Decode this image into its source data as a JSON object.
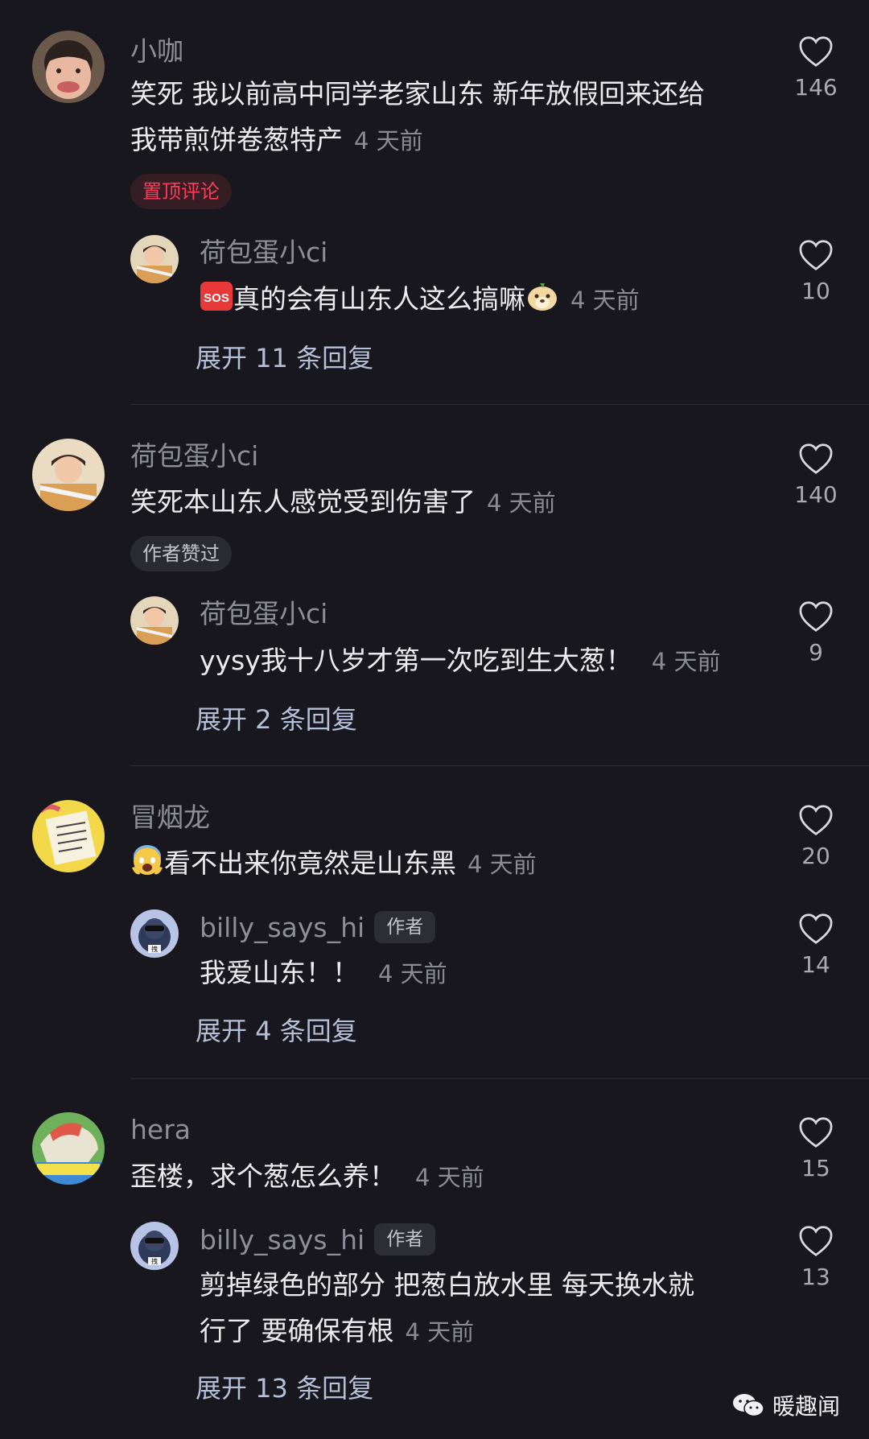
{
  "comments": [
    {
      "user": "小咖",
      "text_line1": "笑死 我以前高中同学老家山东 新年放假回来还给",
      "text_line2": "我带煎饼卷葱特产",
      "time": "4 天前",
      "likes": "146",
      "badge": "置顶评论",
      "reply": {
        "user": "荷包蛋小ci",
        "text": "真的会有山东人这么搞嘛",
        "time": "4 天前",
        "likes": "10"
      },
      "expand": "展开 11 条回复"
    },
    {
      "user": "荷包蛋小ci",
      "text_line1": "笑死本山东人感觉受到伤害了",
      "time": "4 天前",
      "likes": "140",
      "badge": "作者赞过",
      "reply": {
        "user": "荷包蛋小ci",
        "text": "yysy我十八岁才第一次吃到生大葱！",
        "time": "4 天前",
        "likes": "9"
      },
      "expand": "展开 2 条回复"
    },
    {
      "user": "冒烟龙",
      "text_line1": "看不出来你竟然是山东黑",
      "time": "4 天前",
      "likes": "20",
      "reply": {
        "user": "billy_says_hi",
        "tag": "作者",
        "text": "我爱山东！！",
        "time": "4 天前",
        "likes": "14"
      },
      "expand": "展开 4 条回复"
    },
    {
      "user": "hera",
      "text_line1": "歪楼，求个葱怎么养！",
      "time": "4 天前",
      "likes": "15",
      "reply": {
        "user": "billy_says_hi",
        "tag": "作者",
        "text_line1": "剪掉绿色的部分 把葱白放水里 每天换水就",
        "text_line2": "行了 要确保有根",
        "time": "4 天前",
        "likes": "13"
      },
      "expand": "展开 13 条回复"
    }
  ],
  "watermark": "暖趣闻",
  "colors": {
    "background": "#17171d",
    "pinned_badge": "#ff3b5c",
    "expand_link": "#b5bfd8"
  },
  "icons": [
    "heart-outline-icon",
    "sos-emoji-icon",
    "dog-face-emoji-icon",
    "screaming-face-emoji-icon",
    "wechat-icon"
  ]
}
